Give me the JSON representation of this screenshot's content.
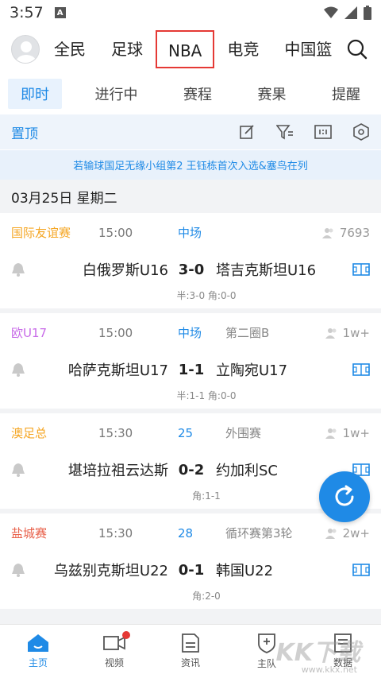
{
  "status": {
    "time": "3:57",
    "a_label": "A"
  },
  "topnav": {
    "tabs": [
      "全民",
      "足球",
      "NBA",
      "电竞",
      "中国篮"
    ]
  },
  "subtabs": [
    "即时",
    "进行中",
    "赛程",
    "赛果",
    "提醒"
  ],
  "toolbar": {
    "pin_label": "置顶"
  },
  "banner": "若输球国足无缘小组第2 王钰栋首次入选&塞鸟在列",
  "date_label": "03月25日 星期二",
  "matches": [
    {
      "league": "国际友谊赛",
      "league_color": "#f5a623",
      "time": "15:00",
      "status": "中场",
      "round": "",
      "viewers": "7693",
      "home": "白俄罗斯U16",
      "score": "3-0",
      "away": "塔吉克斯坦U16",
      "detail": "半:3-0 角:0-0"
    },
    {
      "league": "欧U17",
      "league_color": "#c86be8",
      "time": "15:00",
      "status": "中场",
      "round": "第二圈B",
      "viewers": "1w+",
      "home": "哈萨克斯坦U17",
      "score": "1-1",
      "away": "立陶宛U17",
      "detail": "半:1-1 角:0-0"
    },
    {
      "league": "澳足总",
      "league_color": "#f5a623",
      "time": "15:30",
      "status": "25",
      "round": "外围赛",
      "viewers": "1w+",
      "home": "堪培拉祖云达斯",
      "score": "0-2",
      "away": "约加利SC",
      "detail": "角:1-1"
    },
    {
      "league": "盐城赛",
      "league_color": "#e8604a",
      "time": "15:30",
      "status": "28",
      "round": "循环赛第3轮",
      "viewers": "2w+",
      "home": "乌兹别克斯坦U22",
      "score": "0-1",
      "away": "韩国U22",
      "detail": "角:2-0"
    }
  ],
  "bottomnav": [
    {
      "label": "主页",
      "icon": "home-icon"
    },
    {
      "label": "视频",
      "icon": "video-icon"
    },
    {
      "label": "资讯",
      "icon": "news-icon"
    },
    {
      "label": "主队",
      "icon": "team-icon"
    },
    {
      "label": "数据",
      "icon": "data-icon"
    }
  ],
  "watermark": "KK下载",
  "watermark_url": "www.kkx.net",
  "colors": {
    "accent": "#1f8ae6",
    "highlight_border": "#e53935"
  }
}
